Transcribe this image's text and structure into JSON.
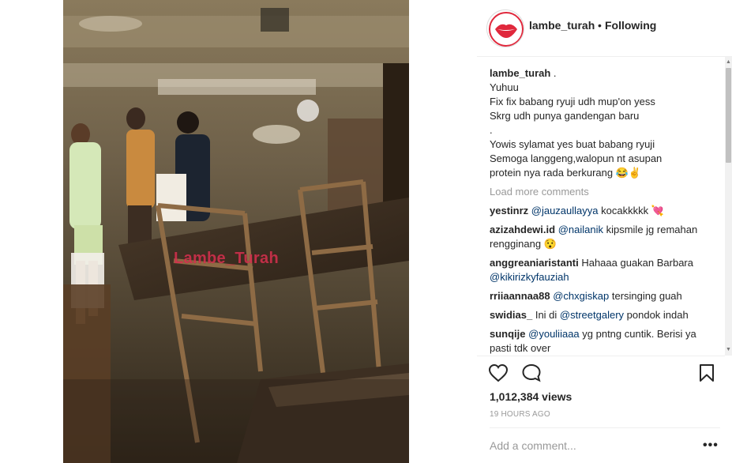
{
  "post": {
    "username": "lambe_turah",
    "separator": "•",
    "follow_status": "Following",
    "watermark": "Lambe_Turah",
    "caption": {
      "username": "lambe_turah",
      "username_suffix": " .",
      "lines": [
        "Yuhuu",
        "Fix fix babang ryuji udh mup'on yess",
        "Skrg udh punya gandengan baru",
        ".",
        "Yowis sylamat yes buat babang ryuji",
        "Semoga langgeng,walopun nt asupan",
        "protein nya rada berkurang 😂✌"
      ]
    },
    "load_more": "Load more comments",
    "comments": [
      {
        "user": "yestinrz",
        "mention": "@jauzaullayya",
        "text": " kocakkkkk 💘"
      },
      {
        "user": "azizahdewi.id",
        "mention": "@nailanik",
        "text": " kipsmile jg remahan rengginang 😯"
      },
      {
        "user": "anggreaniaristanti",
        "mention": "",
        "text": "Hahaaa guakan Barbara",
        "mention_after": "@kikirizkyfauziah"
      },
      {
        "user": "rriiaannaa88",
        "mention": "@chxgiskap",
        "text": " tersinging guah"
      },
      {
        "user": "swidias_",
        "mention_before": "Ini di ",
        "mention": "@streetgalery",
        "text": " pondok indah"
      },
      {
        "user": "sunqije",
        "mention": "@youliiaaa",
        "text": " yg pntng cuntik. Berisi ya pasti tdk over"
      }
    ],
    "views": "1,012,384 views",
    "timestamp": "19 HOURS AGO",
    "add_comment_placeholder": "Add a comment...",
    "more_options": "•••"
  },
  "icons": {
    "like": "heart-icon",
    "comment": "speech-bubble-icon",
    "save": "bookmark-icon",
    "more": "more-options-icon"
  },
  "colors": {
    "mention": "#003569",
    "muted": "#999999",
    "watermark": "#d6314f",
    "avatar_red": "#e0283c"
  }
}
